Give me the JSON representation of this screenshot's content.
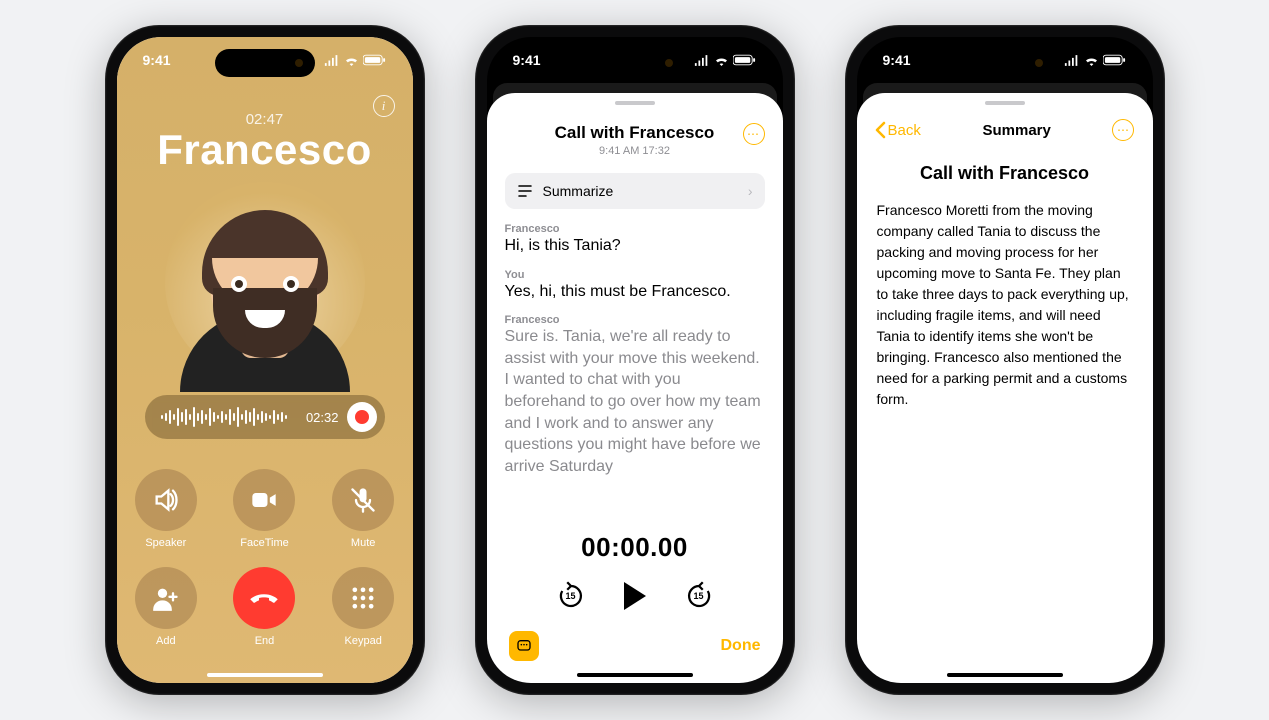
{
  "status": {
    "time": "9:41"
  },
  "call": {
    "duration": "02:47",
    "name": "Francesco",
    "recording_time": "02:32",
    "buttons": {
      "speaker": "Speaker",
      "facetime": "FaceTime",
      "mute": "Mute",
      "add": "Add",
      "end": "End",
      "keypad": "Keypad"
    }
  },
  "transcript": {
    "title": "Call with Francesco",
    "subtitle": "9:41 AM  17:32",
    "summarize_label": "Summarize",
    "segments": [
      {
        "speaker": "Francesco",
        "text": "Hi, is this Tania?"
      },
      {
        "speaker": "You",
        "text": "Yes, hi, this must be Francesco."
      },
      {
        "speaker": "Francesco",
        "text": "Sure is. Tania, we're all ready to assist with your move this weekend. I wanted to chat with you beforehand to go over how my team and I work and to answer any questions you might have before we arrive Saturday"
      }
    ],
    "player_time": "00:00.00",
    "skip": "15",
    "done": "Done"
  },
  "summary": {
    "back": "Back",
    "header": "Summary",
    "title": "Call with Francesco",
    "body": "Francesco Moretti from the moving company called Tania to discuss the packing and moving process for her upcoming move to Santa Fe. They plan to take three days to pack everything up, including fragile items, and will need Tania to identify items she won't be bringing. Francesco also mentioned the need for a parking permit and a customs form."
  }
}
